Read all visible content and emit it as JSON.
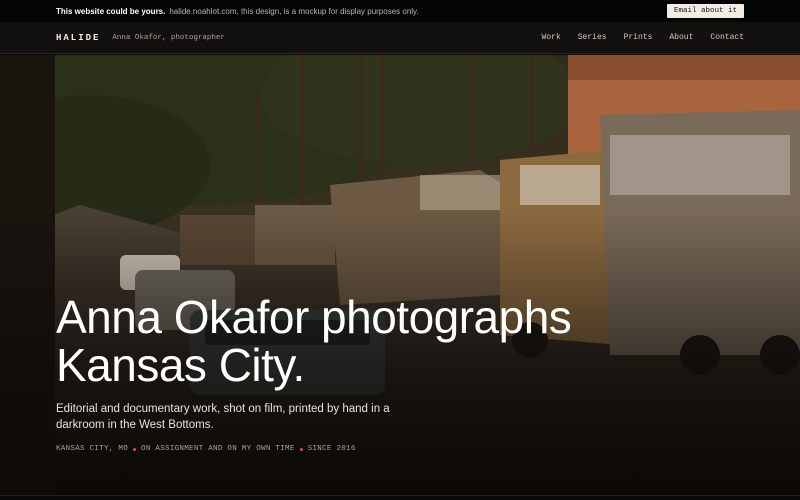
{
  "banner": {
    "strong": "This website could be yours.",
    "text": "halide.noahlot.com, this design, is a mockup for display purposes only.",
    "button": "Email about it"
  },
  "nav": {
    "brand": "HALIDE",
    "subtitle": "Anna Okafor, photographer",
    "links": [
      "Work",
      "Series",
      "Prints",
      "About",
      "Contact"
    ]
  },
  "hero": {
    "title_line1": "Anna Okafor photographs",
    "title_line2": "Kansas City.",
    "subtitle": "Editorial and documentary work, shot on film, printed by hand in a darkroom in the West Bottoms.",
    "meta": [
      "KANSAS CITY, MO",
      "ON ASSIGNMENT AND ON MY OWN TIME",
      "SINCE 2016"
    ],
    "accent_color": "#d9542c"
  }
}
